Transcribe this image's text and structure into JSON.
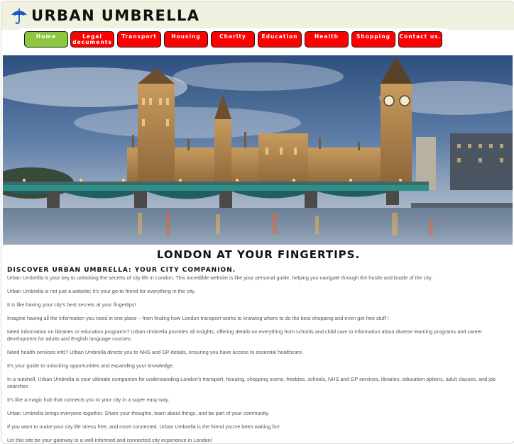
{
  "header": {
    "title": "URBAN UMBRELLA",
    "logo_icon": "umbrella-icon"
  },
  "nav": {
    "items": [
      {
        "label": "Home",
        "active": true
      },
      {
        "label": "Legal documents",
        "active": false
      },
      {
        "label": "Transport",
        "active": false
      },
      {
        "label": "Housing",
        "active": false
      },
      {
        "label": "Charity",
        "active": false
      },
      {
        "label": "Education",
        "active": false
      },
      {
        "label": "Health",
        "active": false
      },
      {
        "label": "Shopping",
        "active": false
      },
      {
        "label": "Contact us.",
        "active": false
      }
    ],
    "colors": {
      "default": "#ff0000",
      "active": "#8dc63f",
      "text": "#ffffff"
    }
  },
  "hero": {
    "image": "westminster-palace-big-ben-bridge-photo"
  },
  "main": {
    "heading": "LONDON AT YOUR FINGERTIPS.",
    "subheading": "DISCOVER URBAN UMBRELLA: YOUR CITY COMPANION.",
    "paragraphs": [
      "Urban Umbrella is your key to unlocking the secrets of city life in London. This incredible website is like your personal guide, helping you navigate through the hustle and bustle of the city.",
      "Urban Umbrella is not just a website; it's your go-to friend for everything in the city.",
      "It is like having your city's best secrets at your fingertips!",
      "Imagine having all the information you need in one place – from finding how London transport works to knowing where to do the best shopping and even get free stuff !",
      "Need information on libraries or education programs? Urban Umbrella provides all insights, offering details on everything from schools and child care to information about diverse learning programs and career development for adults and English language courses.",
      "Need health services info? Urban Umbrella directs you to NHS and GP details, ensuring you have access to essential healthcare.",
      "It's your guide to unlocking opportunities and expanding your knowledge.",
      "In a nutshell, Urban Umbrella is your ultimate companion for understanding London's transport, housing, shopping scene, freebies, schools, NHS and GP services, libraries, education options, adult classes, and job searches",
      "It's like a magic hub that connects you to your city in a super easy way.",
      "Urban Umbrella brings everyone together. Share your thoughts, learn about things, and be part of your community.",
      "If you want to make your city life stress free, and more connected, Urban Umbrella is the friend you've been waiting for!",
      "Let this site be your gateway to a well-informed and connected city experience in London!"
    ]
  }
}
